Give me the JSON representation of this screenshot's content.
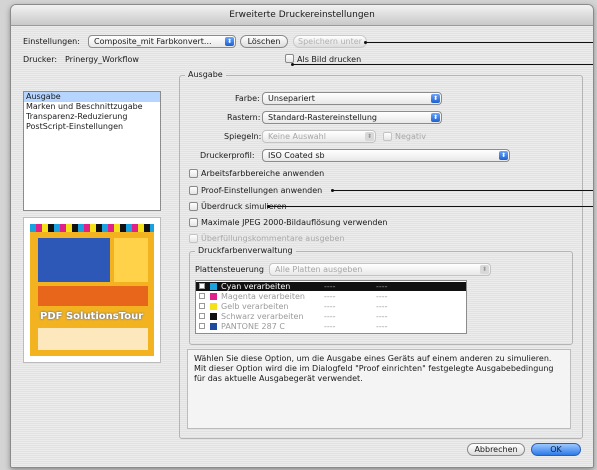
{
  "window": {
    "title": "Erweiterte Druckereinstellungen"
  },
  "top": {
    "einstellungen_label": "Einstellungen:",
    "einstellungen_value": "Composite_mit Farbkonvert...",
    "loeschen_label": "Löschen",
    "speichern_label": "Speichern unter",
    "drucker_label": "Drucker:",
    "drucker_value": "Prinergy_Workflow",
    "als_bild_label": "Als Bild drucken"
  },
  "sidebar": {
    "items": [
      {
        "label": "Ausgabe"
      },
      {
        "label": "Marken und Beschnittzugabe"
      },
      {
        "label": "Transparenz-Reduzierung"
      },
      {
        "label": "PostScript-Einstellungen"
      }
    ]
  },
  "preview": {
    "headline": "PDF SolutionsTour"
  },
  "ausgabe": {
    "legend": "Ausgabe",
    "farbe_label": "Farbe:",
    "farbe_value": "Unsepariert",
    "rastern_label": "Rastern:",
    "rastern_value": "Standard-Rastereinstellung",
    "spiegeln_label": "Spiegeln:",
    "spiegeln_value": "Keine Auswahl",
    "negativ_label": "Negativ",
    "druckerprofil_label": "Druckerprofil:",
    "druckerprofil_value": "ISO Coated sb",
    "checkboxes": [
      {
        "label": "Arbeitsfarbbereiche anwenden"
      },
      {
        "label": "Proof-Einstellungen anwenden"
      },
      {
        "label": "Überdruck simulieren"
      },
      {
        "label": "Maximale JPEG 2000-Bildauflösung verwenden"
      },
      {
        "label": "Überfüllungskommentare ausgeben"
      }
    ]
  },
  "ink": {
    "legend": "Druckfarbenverwaltung",
    "plattensteuerung_label": "Plattensteuerung",
    "plattensteuerung_value": "Alle Platten ausgeben",
    "rows": [
      {
        "name": "Cyan verarbeiten",
        "swatch": "#1aa3e0",
        "c1": "----",
        "c2": "----"
      },
      {
        "name": "Magenta verarbeiten",
        "swatch": "#e0218a",
        "c1": "----",
        "c2": "----"
      },
      {
        "name": "Gelb verarbeiten",
        "swatch": "#f5e11a",
        "c1": "----",
        "c2": "----"
      },
      {
        "name": "Schwarz verarbeiten",
        "swatch": "#111111",
        "c1": "----",
        "c2": "----"
      },
      {
        "name": "PANTONE 287 C",
        "swatch": "#1f4aa0",
        "c1": "----",
        "c2": "----"
      }
    ]
  },
  "description": "Wählen Sie diese Option, um die Ausgabe eines Geräts auf einem anderen zu simulieren. Mit dieser Option wird die im Dialogfeld \"Proof einrichten\" festgelegte Ausgabebedingung für das aktuelle Ausgabegerät verwendet.",
  "footer": {
    "abbrechen_label": "Abbrechen",
    "ok_label": "OK"
  },
  "colors": {
    "accent": "#2e79e8",
    "selection": "#b5d5ff"
  }
}
